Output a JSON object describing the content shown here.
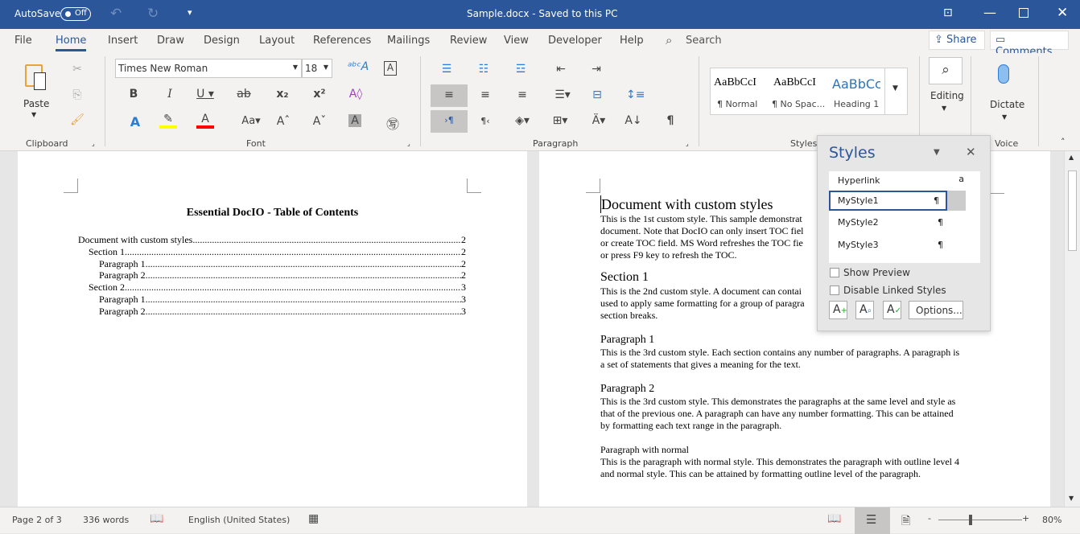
{
  "titlebar": {
    "autosave_label": "AutoSave",
    "autosave_state": "Off",
    "title": "Sample.docx  -  Saved to this PC"
  },
  "menu": {
    "tabs": [
      "File",
      "Home",
      "Insert",
      "Draw",
      "Design",
      "Layout",
      "References",
      "Mailings",
      "Review",
      "View",
      "Developer",
      "Help"
    ],
    "active": "Home",
    "search": "Search",
    "share": "Share",
    "comments": "Comments"
  },
  "ribbon": {
    "paste": "Paste",
    "clipboard": "Clipboard",
    "font_name": "Times New Roman",
    "font_size": "18",
    "font": "Font",
    "paragraph": "Paragraph",
    "styles": "Styles",
    "editing": "Editing",
    "dictate": "Dictate",
    "voice": "Voice",
    "gallery": [
      {
        "preview": "AaBbCcI",
        "name": "¶ Normal"
      },
      {
        "preview": "AaBbCcI",
        "name": "¶ No Spac..."
      },
      {
        "preview": "AaBbCc",
        "name": "Heading 1"
      }
    ],
    "colors": {
      "highlight": "#ffff00",
      "font_color": "#ff0000",
      "accent": "#2b579a"
    }
  },
  "left_page": {
    "title": "Essential DocIO - Table of Contents",
    "toc": [
      {
        "text": "Document with custom styles",
        "page": "2",
        "level": 0
      },
      {
        "text": "Section 1",
        "page": "2",
        "level": 1
      },
      {
        "text": "Paragraph 1",
        "page": "2",
        "level": 2
      },
      {
        "text": "Paragraph 2",
        "page": "2",
        "level": 2
      },
      {
        "text": "Section 2",
        "page": "3",
        "level": 1
      },
      {
        "text": "Paragraph 1",
        "page": "3",
        "level": 2
      },
      {
        "text": "Paragraph 2",
        "page": "3",
        "level": 2
      }
    ]
  },
  "right_page": {
    "h1": "Document with custom styles",
    "p1": [
      "This is the 1st custom style. This sample demonstrat",
      "document. Note that DocIO can only insert TOC fiel",
      "or create TOC field. MS Word refreshes the TOC fie",
      "or press F9 key to refresh the TOC."
    ],
    "h2": "Section 1",
    "p2": [
      "This is the 2nd custom style. A document can contai",
      "used to apply same formatting for a group of paragra",
      "section breaks."
    ],
    "h3": "Paragraph 1",
    "p3": [
      "This is the 3rd custom style. Each section contains any number of paragraphs. A paragraph is",
      "a set of statements that gives a meaning for the text."
    ],
    "h4": "Paragraph 2",
    "p4": [
      "This is the 3rd custom style. This demonstrates the paragraphs at the same level and style as",
      "that of the previous one. A paragraph can have any number formatting. This can be attained",
      "by formatting each text range in the paragraph."
    ],
    "h5": "Paragraph with normal",
    "p5": [
      "This is the paragraph with normal style. This demonstrates the paragraph with outline level 4",
      "and normal style. This can be attained by formatting outline level of the paragraph."
    ]
  },
  "styles_pane": {
    "title": "Styles",
    "items": [
      {
        "name": "Hyperlink",
        "mark": "a"
      },
      {
        "name": "MyStyle1",
        "mark": "¶"
      },
      {
        "name": "MyStyle2",
        "mark": "¶"
      },
      {
        "name": "MyStyle3",
        "mark": "¶"
      }
    ],
    "selected": "MyStyle1",
    "show_preview": "Show Preview",
    "disable_linked": "Disable Linked Styles",
    "options": "Options..."
  },
  "status": {
    "page": "Page 2 of 3",
    "words": "336 words",
    "language": "English (United States)",
    "zoom": "80%",
    "zoom_percent": 80
  }
}
